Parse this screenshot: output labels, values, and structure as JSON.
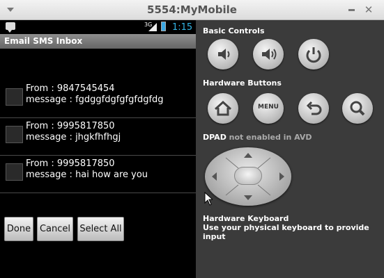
{
  "window": {
    "title": "5554:MyMobile"
  },
  "phone": {
    "status": {
      "network": "3G",
      "time": "1:15"
    },
    "app_title": "Email SMS Inbox",
    "messages": [
      {
        "from": "From : 9847545454",
        "message": "message : fgdggfdgfgfgfdgfdg"
      },
      {
        "from": "From : 9995817850",
        "message": "message : jhgkfhfhgj"
      },
      {
        "from": "From : 9995817850",
        "message": "message : hai how are you"
      }
    ],
    "buttons": {
      "done": "Done",
      "cancel": "Cancel",
      "select_all": "Select All"
    }
  },
  "controls": {
    "basic_label": "Basic Controls",
    "hardware_label": "Hardware Buttons",
    "menu_label": "MENU",
    "dpad_label": "DPAD",
    "dpad_note": "not enabled in AVD",
    "keyboard_title": "Hardware Keyboard",
    "keyboard_desc": "Use your physical keyboard to provide input"
  },
  "colors": {
    "accent": "#33b5e5",
    "panel_bg": "#3b3b3b",
    "screen_bg": "#000000"
  }
}
